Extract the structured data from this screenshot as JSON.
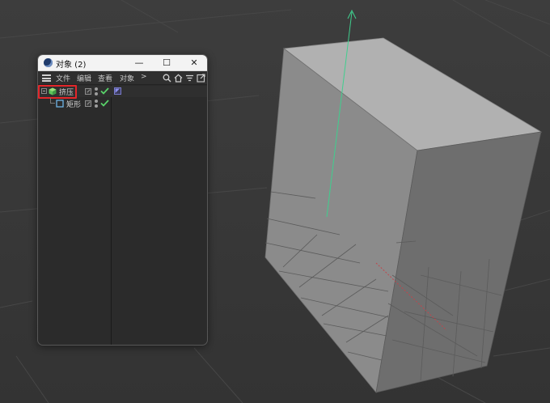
{
  "window": {
    "title": "对象 (2)",
    "buttons": {
      "minimize": "—",
      "maximize": "☐",
      "close": "✕"
    }
  },
  "menu": {
    "items": [
      "文件",
      "编辑",
      "查看",
      "对象"
    ],
    "more": ">"
  },
  "toolbar": {
    "icons": [
      "search-icon",
      "home-icon",
      "filter-icon",
      "new-window-icon"
    ]
  },
  "objects": [
    {
      "name": "挤压",
      "type": "extrude",
      "selected": true,
      "visible": true
    },
    {
      "name": "矩形",
      "type": "rectangle",
      "selected": false,
      "visible": true
    }
  ],
  "colors": {
    "selection_highlight": "#e3262a",
    "check": "#59d36a",
    "extrude_icon": "#5ec25a",
    "rectangle_icon": "#6fb4e6",
    "tag_icon": "#8c8ff0",
    "y_axis": "#3fcf8e",
    "x_axis": "#c0464c"
  }
}
